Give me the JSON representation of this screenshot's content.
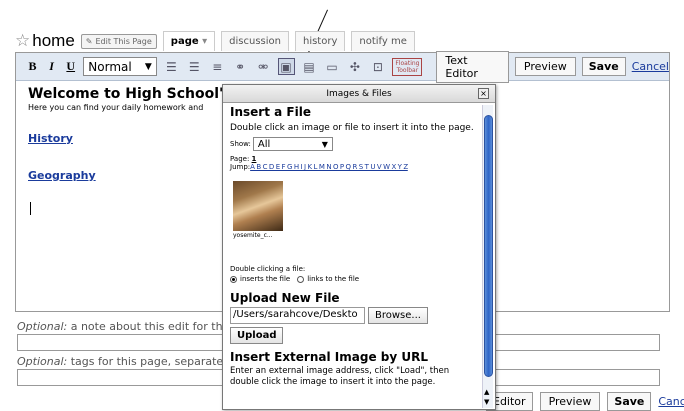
{
  "header": {
    "home_label": "home",
    "edit_button": "Edit This Page",
    "tabs": [
      "page",
      "discussion",
      "history",
      "notify me"
    ]
  },
  "toolbar": {
    "bold": "B",
    "italic": "I",
    "underline": "U",
    "format_value": "Normal",
    "floating_toolbar": "Floating Toolbar",
    "text_editor": "Text Editor",
    "preview": "Preview",
    "save": "Save",
    "cancel": "Cancel"
  },
  "content": {
    "title": "Welcome to High School's Cl",
    "intro": "Here you can find your daily homework and",
    "link1": "History",
    "link2": "Geography"
  },
  "form": {
    "optional1_prefix": "Optional:",
    "optional1_rest": " a note about this edit for the",
    "optional2_prefix": "Optional:",
    "optional2_rest": " tags for this page, separated"
  },
  "bottom_toolbar": {
    "editor": "Editor",
    "preview": "Preview",
    "save": "Save",
    "cancel": "Cancel"
  },
  "dialog": {
    "title": "Images & Files",
    "insert_heading": "Insert a File",
    "insert_desc": "Double click an image or file to insert it into the page.",
    "show_label": "Show:",
    "show_value": "All",
    "page_label": "Page:",
    "page_value": "1",
    "jump_label": "Jump:",
    "jump_letters": "A B C D E F G H I J K L M N O P Q R S T U V W X Y Z",
    "thumb_name": "yosemite_c...",
    "dbl_label": "Double clicking a file:",
    "radio1": "inserts the file",
    "radio2": "links to the file",
    "upload_heading": "Upload New File",
    "file_path": "/Users/sarahcove/Deskto",
    "browse": "Browse...",
    "upload": "Upload",
    "external_heading": "Insert External Image by URL",
    "external_desc": "Enter an external image address, click \"Load\", then double click the image to insert it into the page."
  }
}
